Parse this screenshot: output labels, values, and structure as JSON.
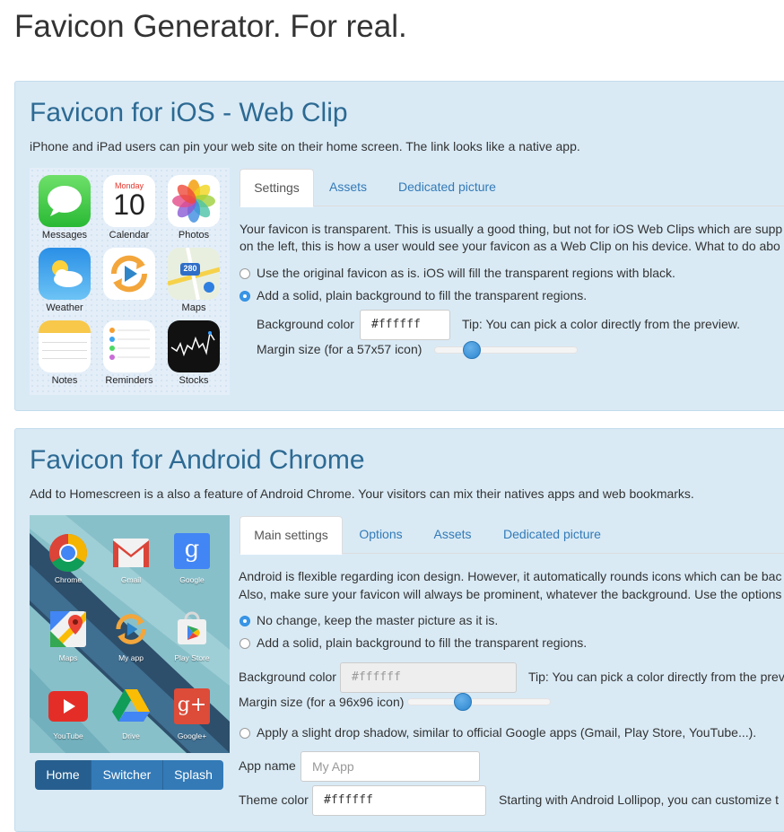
{
  "page": {
    "title": "Favicon Generator. For real."
  },
  "colors": {
    "panel_bg": "#d9eaf5",
    "heading": "#2d6a93",
    "link": "#337ab7",
    "radio_on": "#3a95e6"
  },
  "ios": {
    "title": "Favicon for iOS - Web Clip",
    "description": "iPhone and iPad users can pin your web site on their home screen. The link looks like a native app.",
    "apps": [
      {
        "label": "Messages",
        "icon": "messages-icon"
      },
      {
        "label": "Calendar",
        "icon": "calendar-icon",
        "weekday": "Monday",
        "day": "10"
      },
      {
        "label": "Photos",
        "icon": "photos-icon"
      },
      {
        "label": "Weather",
        "icon": "weather-icon"
      },
      {
        "label": "",
        "icon": "refresh-play-icon"
      },
      {
        "label": "Maps",
        "icon": "maps-icon",
        "badge": "280"
      },
      {
        "label": "Notes",
        "icon": "notes-icon"
      },
      {
        "label": "Reminders",
        "icon": "reminders-icon"
      },
      {
        "label": "Stocks",
        "icon": "stocks-icon"
      }
    ],
    "tabs": [
      "Settings",
      "Assets",
      "Dedicated picture"
    ],
    "active_tab": "Settings",
    "intro_line1": "Your favicon is transparent. This is usually a good thing, but not for iOS Web Clips which are supp",
    "intro_line2": "on the left, this is how a user would see your favicon as a Web Clip on his device. What to do abo",
    "option_original": "Use the original favicon as is. iOS will fill the transparent regions with black.",
    "option_solid": "Add a solid, plain background to fill the transparent regions.",
    "selected_option": "solid",
    "bg_color_label": "Background color",
    "bg_color_value": "#ffffff",
    "tip": "Tip: You can pick a color directly from the preview.",
    "margin_label": "Margin size (for a 57x57 icon)",
    "margin_fraction": 0.26
  },
  "android": {
    "title": "Favicon for Android Chrome",
    "description": "Add to Homescreen is a also a feature of Android Chrome. Your visitors can mix their natives apps and web bookmarks.",
    "apps": [
      {
        "label": "Chrome",
        "icon": "chrome-icon"
      },
      {
        "label": "Gmail",
        "icon": "gmail-icon"
      },
      {
        "label": "Google",
        "icon": "google-icon"
      },
      {
        "label": "Maps",
        "icon": "maps-icon"
      },
      {
        "label": "My app",
        "icon": "refresh-play-icon"
      },
      {
        "label": "Play Store",
        "icon": "play-store-icon"
      },
      {
        "label": "YouTube",
        "icon": "youtube-icon"
      },
      {
        "label": "Drive",
        "icon": "drive-icon"
      },
      {
        "label": "Google+",
        "icon": "google-plus-icon"
      }
    ],
    "preview_buttons": [
      "Home",
      "Switcher",
      "Splash"
    ],
    "active_button": "Home",
    "tabs": [
      "Main settings",
      "Options",
      "Assets",
      "Dedicated picture"
    ],
    "active_tab": "Main settings",
    "intro_line1": "Android is flexible regarding icon design. However, it automatically rounds icons which can be bac",
    "intro_line2": "Also, make sure your favicon will always be prominent, whatever the background. Use the options",
    "option_nochange": "No change, keep the master picture as it is.",
    "option_solid": "Add a solid, plain background to fill the transparent regions.",
    "selected_option": "nochange",
    "bg_color_label": "Background color",
    "bg_color_placeholder": "#ffffff",
    "tip": "Tip: You can pick a color directly from the prev",
    "margin_label": "Margin size (for a 96x96 icon)",
    "margin_fraction": 0.39,
    "shadow_option": "Apply a slight drop shadow, similar to official Google apps (Gmail, Play Store, YouTube...).",
    "app_name_label": "App name",
    "app_name_placeholder": "My App",
    "theme_color_label": "Theme color",
    "theme_color_value": "#ffffff",
    "theme_tip": "Starting with Android Lollipop, you can customize t"
  }
}
